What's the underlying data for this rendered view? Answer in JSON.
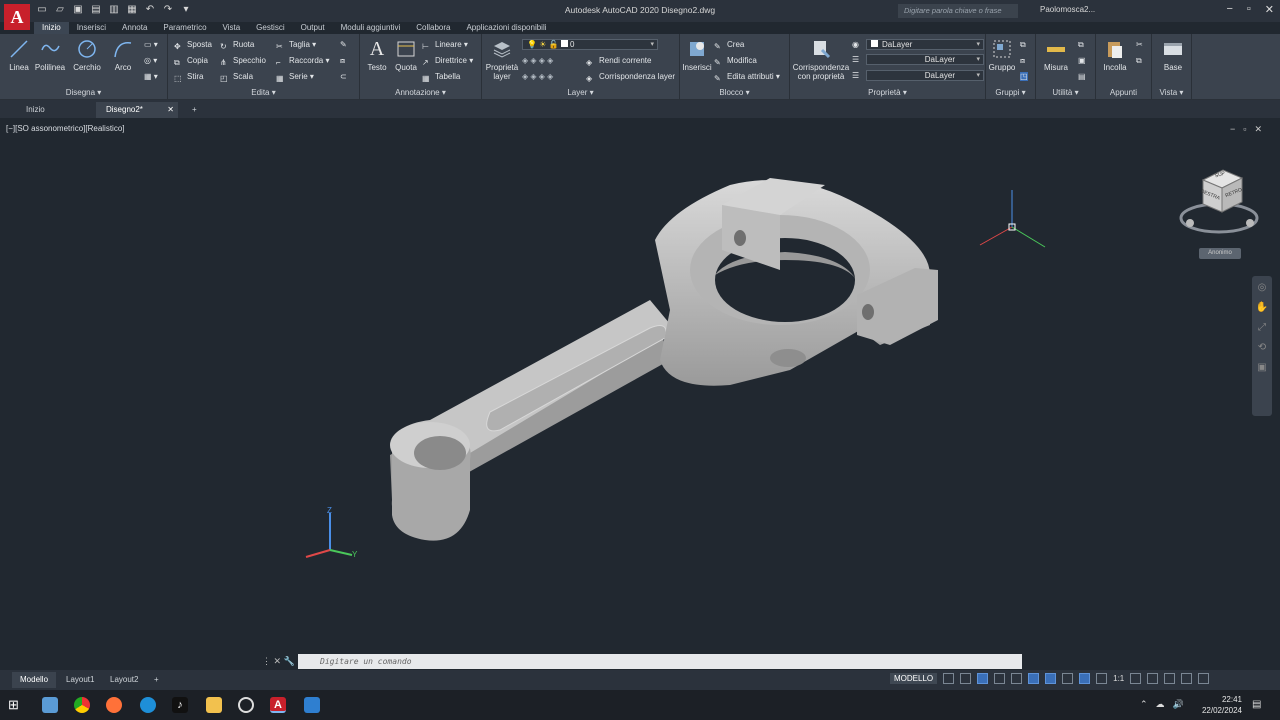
{
  "title": "Autodesk AutoCAD 2020   Disegno2.dwg",
  "search_placeholder": "Digitare parola chiave o frase",
  "user": "Paolomosca2...",
  "tabs": [
    "Inizio",
    "Inserisci",
    "Annota",
    "Parametrico",
    "Vista",
    "Gestisci",
    "Output",
    "Moduli aggiuntivi",
    "Collabora",
    "Applicazioni disponibili"
  ],
  "disegna": {
    "title": "Disegna",
    "linea": "Linea",
    "polilinea": "Polilinea",
    "cerchio": "Cerchio",
    "arco": "Arco"
  },
  "edita": {
    "title": "Edita",
    "sposta": "Sposta",
    "ruota": "Ruota",
    "taglia": "Taglia",
    "copia": "Copia",
    "specchio": "Specchio",
    "raccorda": "Raccorda",
    "stira": "Stira",
    "scala": "Scala",
    "serie": "Serie"
  },
  "annotazione": {
    "title": "Annotazione",
    "testo": "Testo",
    "quota": "Quota",
    "lineare": "Lineare",
    "direttrice": "Direttrice",
    "tabella": "Tabella"
  },
  "layer": {
    "title": "Layer",
    "proprieta": "Proprietà layer",
    "current": "0",
    "rendi_corrente": "Rendi corrente",
    "corrispondenza": "Corrispondenza layer"
  },
  "blocco": {
    "title": "Blocco",
    "inserisci": "Inserisci",
    "crea": "Crea",
    "modifica": "Modifica",
    "edita_attributi": "Edita attributi"
  },
  "proprieta": {
    "title": "Proprietà",
    "corrispondenza": "Corrispondenza con proprietà",
    "color": "DaLayer",
    "linetype": "DaLayer",
    "lineweight": "DaLayer"
  },
  "gruppi": {
    "title": "Gruppi",
    "gruppo": "Gruppo"
  },
  "utilita": {
    "title": "Utilità",
    "misura": "Misura"
  },
  "appunti": {
    "title": "Appunti",
    "incolla": "Incolla"
  },
  "vista": {
    "title": "Vista",
    "base": "Base"
  },
  "file_tabs": {
    "home": "Inizio",
    "active": "Disegno2*"
  },
  "viewport_label": "[−][SO assonometrico][Realistico]",
  "viewcube": {
    "top": "SUP",
    "left": "DESTRA",
    "right": "RETRO",
    "wcs": "Anonimo"
  },
  "command_placeholder": "Digitare un comando",
  "layout_tabs": [
    "Modello",
    "Layout1",
    "Layout2"
  ],
  "status": {
    "mode": "MODELLO",
    "scale": "1:1"
  },
  "clock": {
    "time": "22:41",
    "date": "22/02/2024"
  },
  "icons": [
    "autocad-logo",
    "new-icon",
    "open-icon",
    "save-icon",
    "saveas-icon",
    "plot-icon",
    "undo-icon",
    "redo-icon"
  ]
}
